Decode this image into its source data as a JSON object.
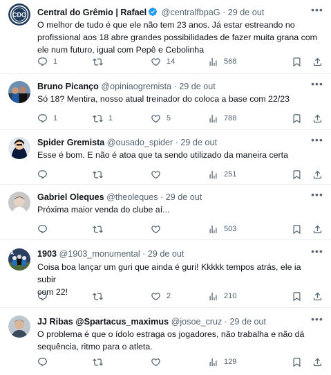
{
  "tweets": [
    {
      "name": "Central do Grêmio | Rafael",
      "handle": "@centralfbpaG",
      "sep": "·",
      "date": "29 de out",
      "verified": true,
      "lines": [
        "O melhor de tudo é que ele não tem 23 anos. Já estar estreando no",
        "profissional aos 18 abre grandes possibilidades de fazer muita grana com",
        "ele num futuro, igual com Pepê e Cebolinha"
      ],
      "replies": "1",
      "retweets": "",
      "likes": "14",
      "views": "568"
    },
    {
      "name": "Bruno Picanço",
      "handle": "@opiniaogremista",
      "sep": "·",
      "date": "29 de out",
      "verified": false,
      "lines": [
        "Só 18? Mentira, nosso atual treinador do coloca a base com 22/23"
      ],
      "replies": "1",
      "retweets": "1",
      "likes": "5",
      "views": "788"
    },
    {
      "name": "Spider Gremista",
      "handle": "@ousado_spider",
      "sep": "·",
      "date": "29 de out",
      "verified": false,
      "lines": [
        "Esse é bom. E não é atoa que ta sendo utilizado da maneira certa"
      ],
      "replies": "",
      "retweets": "",
      "likes": "",
      "views": "251"
    },
    {
      "name": "Gabriel Oleques",
      "handle": "@theoleques",
      "sep": "·",
      "date": "29 de out",
      "verified": false,
      "lines": [
        "Próxima maior venda do clube aí..."
      ],
      "replies": "",
      "retweets": "",
      "likes": "",
      "views": "503"
    },
    {
      "name": "1903",
      "handle": "@1903_monumental",
      "sep": "·",
      "date": "29 de out",
      "verified": false,
      "lines": [
        "Coisa boa lançar um guri que ainda é guri! Kkkkk tempos atrás, ele ia subir",
        "com 22!"
      ],
      "replies": "",
      "retweets": "",
      "likes": "2",
      "views": "210"
    },
    {
      "name": "JJ Ribas @Spartacus_maximus",
      "handle": "@josoe_cruz",
      "sep": "·",
      "date": "29 de out",
      "verified": false,
      "lines": [
        "O problema é que o ídolo estraga os jogadores, não trabalha e não dá",
        "sequência, ritmo para o atleta."
      ],
      "replies": "",
      "retweets": "",
      "likes": "",
      "views": "129"
    }
  ],
  "icons": {
    "reply": "reply-icon",
    "retweet": "retweet-icon",
    "like": "heart-icon",
    "views": "views-icon",
    "bookmark": "bookmark-icon",
    "share": "share-icon",
    "more": "more-icon",
    "verified": "verified-badge-icon"
  },
  "colors": {
    "text": "#0f1419",
    "muted": "#536471",
    "verified": "#1d9bf0",
    "divider": "#eff3f4"
  }
}
